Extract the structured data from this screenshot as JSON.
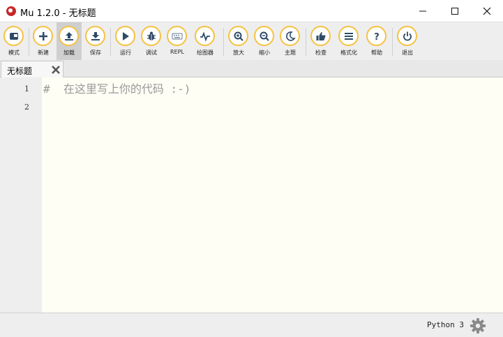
{
  "window": {
    "title": "Mu 1.2.0 - 无标题",
    "minimize": "—",
    "maximize": "☐",
    "close": "✕"
  },
  "toolbar": {
    "buttons": [
      {
        "label": "模式",
        "icon": "mode-icon"
      },
      {
        "label": "新建",
        "icon": "plus-icon"
      },
      {
        "label": "加载",
        "icon": "upload-icon"
      },
      {
        "label": "保存",
        "icon": "download-icon"
      },
      {
        "label": "运行",
        "icon": "play-icon"
      },
      {
        "label": "调试",
        "icon": "bug-icon"
      },
      {
        "label": "REPL",
        "icon": "keyboard-icon"
      },
      {
        "label": "绘图器",
        "icon": "pulse-icon"
      },
      {
        "label": "放大",
        "icon": "zoom-in-icon"
      },
      {
        "label": "缩小",
        "icon": "zoom-out-icon"
      },
      {
        "label": "主题",
        "icon": "moon-icon"
      },
      {
        "label": "检查",
        "icon": "thumbs-up-icon"
      },
      {
        "label": "格式化",
        "icon": "align-icon"
      },
      {
        "label": "帮助",
        "icon": "question-icon"
      },
      {
        "label": "退出",
        "icon": "power-icon"
      }
    ]
  },
  "tabs": [
    {
      "label": "无标题"
    }
  ],
  "editor": {
    "line_numbers": [
      "1",
      "2"
    ],
    "lines": [
      "#  在这里写上你的代码 :-)",
      ""
    ]
  },
  "status": {
    "mode": "Python 3"
  },
  "colors": {
    "accent": "#f5c242",
    "icon": "#2e4a66",
    "editor_bg": "#fefef5"
  }
}
